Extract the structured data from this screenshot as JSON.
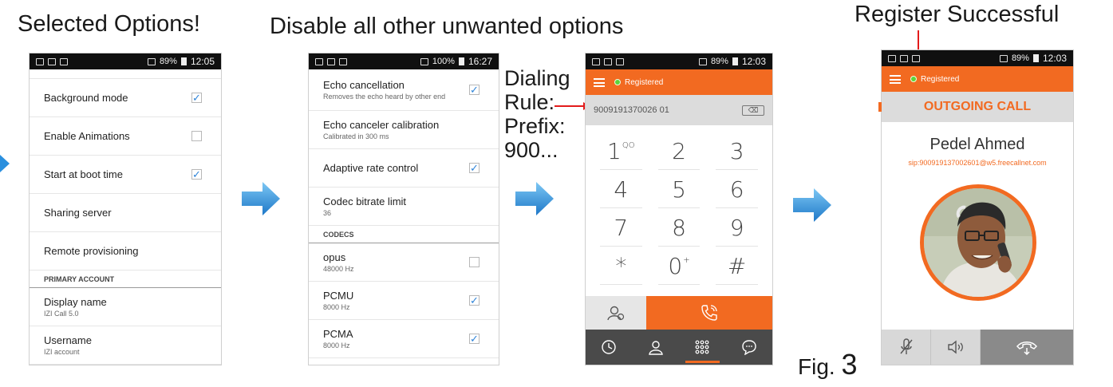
{
  "captions": {
    "step1": "Selected Options!",
    "step2": "Disable all other unwanted options",
    "step4": "Register Successful",
    "dialing_rule": [
      "Dialing",
      "Rule:",
      "Prefix:",
      "900..."
    ],
    "fig_prefix": "Fig.",
    "fig_number": "3"
  },
  "status_bars": {
    "phone1": {
      "battery": "89%",
      "time": "12:05"
    },
    "phone2": {
      "battery": "100%",
      "time": "16:27"
    },
    "phone3": {
      "battery": "89%",
      "time": "12:03"
    },
    "phone4": {
      "battery": "89%",
      "time": "12:03"
    }
  },
  "settings1": {
    "items": [
      {
        "label": "Background mode",
        "checked": true
      },
      {
        "label": "Enable Animations",
        "checked": false
      },
      {
        "label": "Start at boot time",
        "checked": true
      },
      {
        "label": "Sharing server"
      },
      {
        "label": "Remote provisioning"
      }
    ],
    "section": "PRIMARY ACCOUNT",
    "account": [
      {
        "label": "Display name",
        "sub": "IZI Call 5.0"
      },
      {
        "label": "Username",
        "sub": "IZI account"
      }
    ]
  },
  "settings2": {
    "items": [
      {
        "label": "Echo cancellation",
        "sub": "Removes the echo heard by other end",
        "checked": true
      },
      {
        "label": "Echo canceler calibration",
        "sub": "Calibrated in 300 ms"
      },
      {
        "label": "Adaptive rate control",
        "checked": true
      },
      {
        "label": "Codec bitrate limit",
        "sub": "36"
      }
    ],
    "section": "CODECS",
    "codecs": [
      {
        "label": "opus",
        "sub": "48000 Hz",
        "checked": false
      },
      {
        "label": "PCMU",
        "sub": "8000 Hz",
        "checked": true
      },
      {
        "label": "PCMA",
        "sub": "8000 Hz",
        "checked": true
      }
    ]
  },
  "dialer": {
    "status": "Registered",
    "number": "9009191370026 01",
    "backspace": "⌫",
    "keys": [
      {
        "main": "1",
        "sup": "QO"
      },
      {
        "main": "2"
      },
      {
        "main": "3"
      },
      {
        "main": "4"
      },
      {
        "main": "5"
      },
      {
        "main": "6"
      },
      {
        "main": "7"
      },
      {
        "main": "8"
      },
      {
        "main": "9"
      },
      {
        "main": "*"
      },
      {
        "main": "0",
        "sup": "+"
      },
      {
        "main": "#"
      }
    ]
  },
  "call": {
    "status": "Registered",
    "title": "OUTGOING CALL",
    "name": "Pedel Ahmed",
    "sip": "sip:900919137002601@w5.freecallnet.com"
  },
  "colors": {
    "accent": "#f26a21",
    "check": "#2f84d8",
    "registered": "#5cd33b",
    "arrow": "#2a8fde"
  }
}
